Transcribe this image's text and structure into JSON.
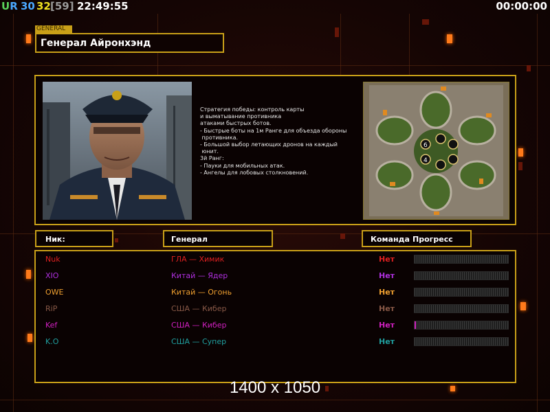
{
  "topbar": {
    "ur_u": "U",
    "ur_r": "R",
    "n30": "30",
    "n32": "32",
    "n59": "[59]",
    "clock": "22:49:55",
    "timer": "00:00:00"
  },
  "general": {
    "tag": "GENERAL",
    "name": "Генерал Айронхэнд"
  },
  "description": [
    "Стратегия победы: контроль карты",
    "и выматывание противника",
    "атаками быстрых ботов.",
    "",
    "- Быстрые боты на 1м Ранге для объезда обороны",
    " противника.",
    "- Большой выбор летающих дронов на каждый",
    " юнит.",
    "",
    "3й Ранг:",
    "- Пауки для мобильных атак.",
    "- Ангелы для лобовых столкновений."
  ],
  "minimap": {
    "marker_6": "6",
    "marker_4": "4"
  },
  "headers": {
    "nick": "Ник:",
    "general": "Генерал",
    "team": "Команда",
    "progress": "Прогресс"
  },
  "players": [
    {
      "nick": "Nuk",
      "general": "ГЛА — Химик",
      "team": "Нет",
      "color": "#e02020",
      "progress": 0
    },
    {
      "nick": "XIO",
      "general": "Китай — Ядер",
      "team": "Нет",
      "color": "#b030e0",
      "progress": 0
    },
    {
      "nick": "OWE",
      "general": "Китай — Огонь",
      "team": "Нет",
      "color": "#f0a030",
      "progress": 0
    },
    {
      "nick": "RiP",
      "general": "США — Кибер",
      "team": "Нет",
      "color": "#8a5a48",
      "progress": 0
    },
    {
      "nick": "Kef",
      "general": "США — Кибер",
      "team": "Нет",
      "color": "#d020c0",
      "progress": 0.01
    },
    {
      "nick": "K.O",
      "general": "США — Супер",
      "team": "Нет",
      "color": "#20a0a0",
      "progress": 0
    }
  ],
  "resolution_text": "1400 x 1050"
}
